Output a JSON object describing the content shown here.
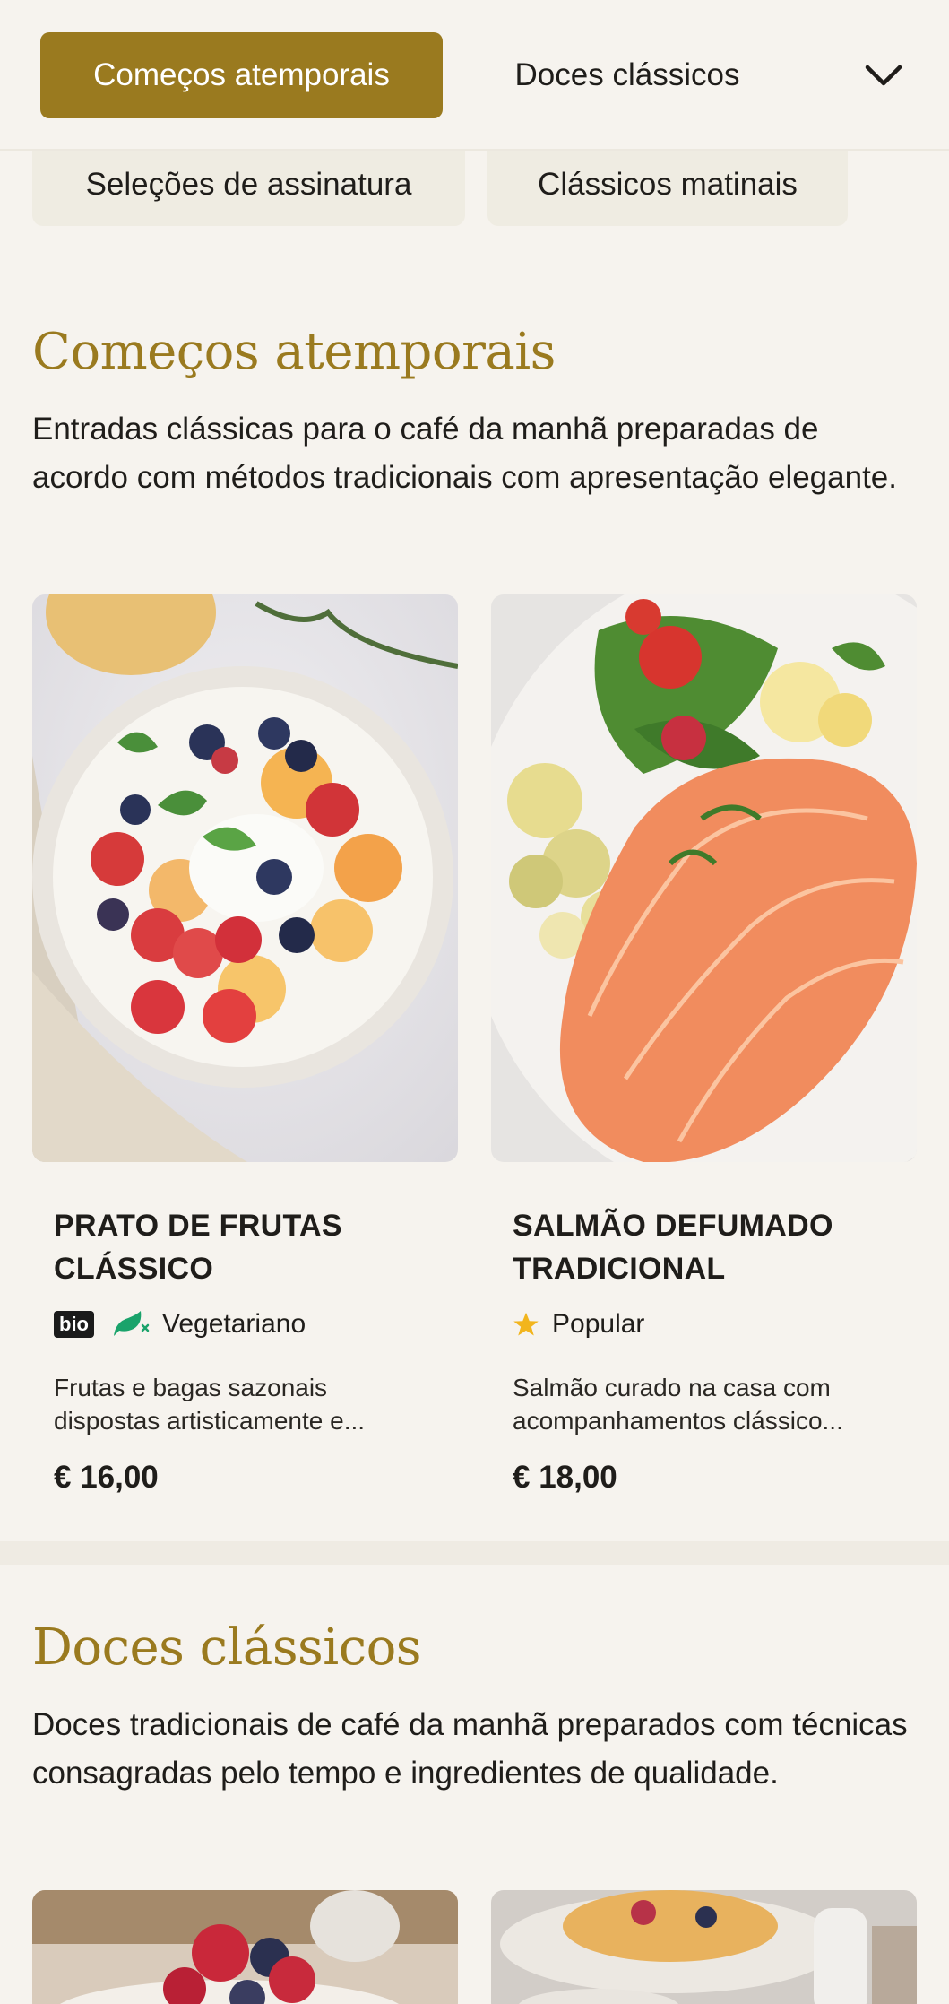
{
  "nav": {
    "active_tab": "Começos atemporais",
    "tab_2": "Doces clássicos",
    "row2_tab_1": "Seleções de assinatura",
    "row2_tab_2": "Clássicos matinais"
  },
  "sections": [
    {
      "title": "Começos atemporais",
      "description": "Entradas clássicas para o café da manhã preparadas de acordo com métodos tradicionais com apresentação elegante.",
      "items": [
        {
          "name_line1": "PRATO DE FRUTAS",
          "name_line2": "CLÁSSICO",
          "badge": "bio",
          "tag": "Vegetariano",
          "tag_icon": "vegetarian-leaf-icon",
          "desc_line1": "Frutas e bagas sazonais",
          "desc_line2": "dispostas artisticamente e...",
          "price": "€ 16,00"
        },
        {
          "name_line1": "SALMÃO DEFUMADO",
          "name_line2": "TRADICIONAL",
          "tag": "Popular",
          "tag_icon": "star-icon",
          "desc_line1": "Salmão curado na casa com",
          "desc_line2": "acompanhamentos clássico...",
          "price": "€ 18,00"
        }
      ]
    },
    {
      "title": "Doces clássicos",
      "description": "Doces tradicionais de café da manhã preparados com técnicas consagradas pelo tempo e ingredientes de qualidade."
    }
  ],
  "colors": {
    "accent": "#9a7a1f",
    "background": "#f6f3ee",
    "star": "#f2b51d",
    "veg_icon": "#1aa36b"
  }
}
